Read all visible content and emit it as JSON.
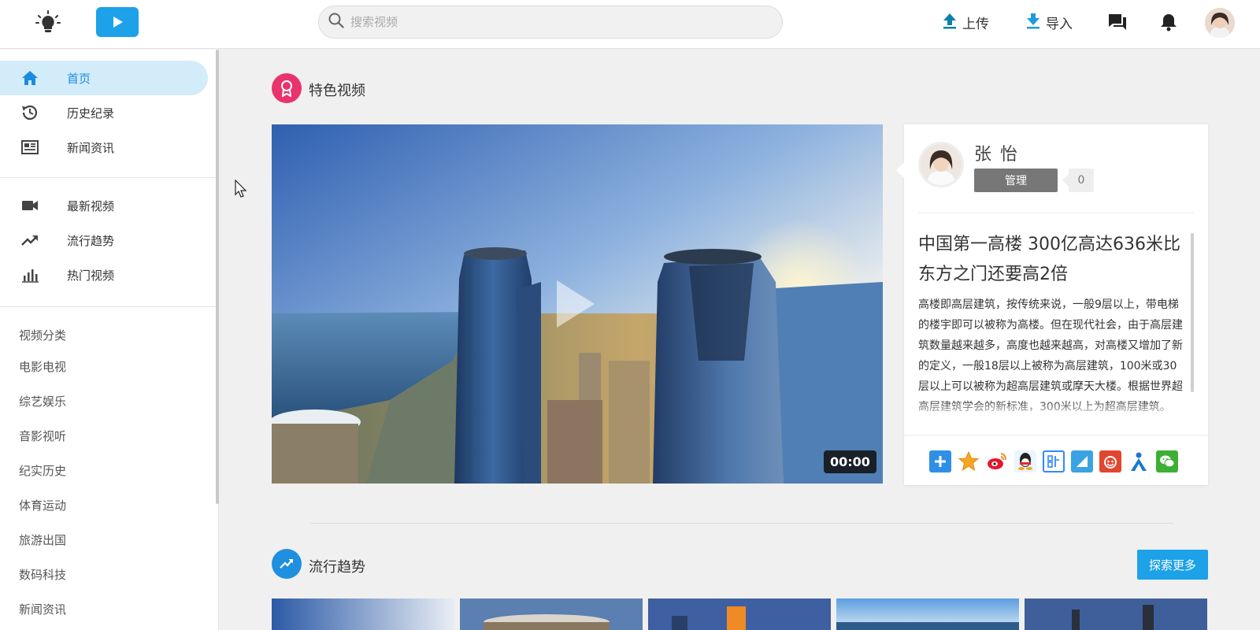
{
  "header": {
    "search_placeholder": "搜索视频",
    "upload_label": "上传",
    "import_label": "导入"
  },
  "sidebar": {
    "primary": [
      {
        "label": "首页",
        "icon": "home-icon",
        "active": true
      },
      {
        "label": "历史纪录",
        "icon": "history-icon",
        "active": false
      },
      {
        "label": "新闻资讯",
        "icon": "news-icon",
        "active": false
      }
    ],
    "secondary": [
      {
        "label": "最新视频",
        "icon": "video-camera-icon"
      },
      {
        "label": "流行趋势",
        "icon": "trending-icon"
      },
      {
        "label": "热门视频",
        "icon": "bar-chart-icon"
      }
    ],
    "categories_title": "视频分类",
    "categories": [
      "电影电视",
      "综艺娱乐",
      "音影视听",
      "纪实历史",
      "体育运动",
      "旅游出国",
      "数码科技",
      "新闻资讯"
    ]
  },
  "featured": {
    "section_title": "特色视频",
    "time": "00:00",
    "author": {
      "name": "张 怡",
      "role": "管理",
      "count": "0"
    },
    "headline": "中国第一高楼 300亿高达636米比东方之门还要高2倍",
    "description": "高楼即高层建筑，按传统来说，一般9层以上，带电梯的楼宇即可以被称为高楼。但在现代社会，由于高层建筑数量越来越多，高度也越来越高，对高楼又增加了新的定义，一般18层以上被称为高层建筑，100米或30层以上可以被称为超高层建筑或摩天大楼。根据世界超高层建筑学会的新标准，300米以上为超高层建筑。",
    "share_icons": [
      {
        "name": "share-plus-icon",
        "color": "#2f8fe6"
      },
      {
        "name": "star-icon",
        "color": "#f5a623"
      },
      {
        "name": "weibo-icon",
        "color": "#e6162d"
      },
      {
        "name": "qq-icon",
        "color": "#1ca0e4"
      },
      {
        "name": "tieba-icon",
        "color": "#3388ff"
      },
      {
        "name": "note-icon",
        "color": "#3aa3e3"
      },
      {
        "name": "renren-icon",
        "color": "#e3462f"
      },
      {
        "name": "people-icon",
        "color": "#1c76d2"
      },
      {
        "name": "wechat-icon",
        "color": "#3cb034"
      }
    ]
  },
  "trending": {
    "section_title": "流行趋势",
    "explore_label": "探索更多"
  },
  "colors": {
    "accent": "#1da1e8",
    "featured_badge": "#e8336d",
    "trending_badge": "#1f8fe0"
  }
}
